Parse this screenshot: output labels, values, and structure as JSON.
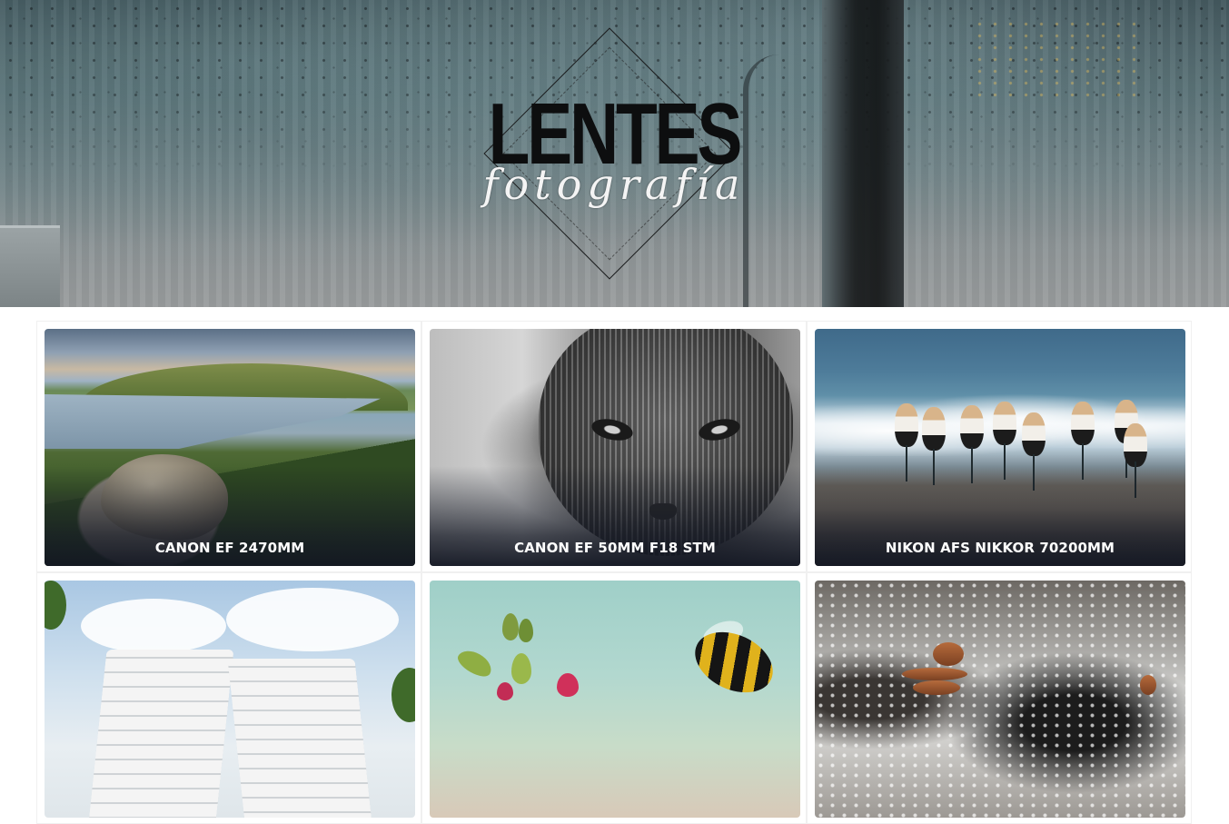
{
  "hero": {
    "logo_title": "LENTES",
    "logo_script": "fotografía"
  },
  "cards": [
    {
      "caption": "CANON EF 2470MM",
      "photo": "lake-landscape"
    },
    {
      "caption": "CANON EF 50MM F18 STM",
      "photo": "black-white-cat"
    },
    {
      "caption": "NIKON AFS NIKKOR 70200MM",
      "photo": "shore-birds"
    },
    {
      "caption": "",
      "photo": "white-buildings-sky"
    },
    {
      "caption": "",
      "photo": "bee-and-flowers"
    },
    {
      "caption": "",
      "photo": "stacked-stones-waterfall"
    }
  ]
}
